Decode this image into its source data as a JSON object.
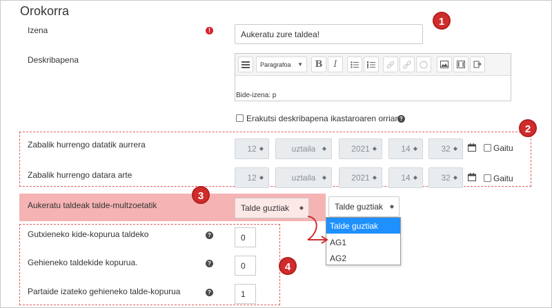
{
  "section": {
    "title": "Orokorra"
  },
  "name_field": {
    "label": "Izena",
    "required_mark": "!",
    "value": "Aukeratu zure taldea!"
  },
  "description": {
    "label": "Deskribapena",
    "toolbar": {
      "paragraph_select": "Paragrafoa",
      "bold": "B",
      "italic": "I",
      "buttons": [
        "collapse-icon",
        "bold-icon",
        "italic-icon",
        "unordered-list-icon",
        "ordered-list-icon",
        "link-icon",
        "unlink-icon",
        "emoji-icon",
        "image-icon",
        "media-icon",
        "manage-files-icon"
      ]
    },
    "path_label": "Bide-izena: p"
  },
  "show_description": {
    "label": "Erakutsi deskribapena ikastaroaren orrian",
    "help": "?"
  },
  "open_from": {
    "label": "Zabalik hurrengo datatik aurrera",
    "day": "12",
    "month": "uztaila",
    "year": "2021",
    "hour": "14",
    "minute": "32",
    "enable_label": "Gaitu"
  },
  "open_until": {
    "label": "Zabalik hurrengo datara arte",
    "day": "12",
    "month": "uztaila",
    "year": "2021",
    "hour": "14",
    "minute": "32",
    "enable_label": "Gaitu"
  },
  "grouping": {
    "label": "Aukeratu taldeak talde-multzoetatik",
    "selected": "Talde guztiak",
    "popup_selected": "Talde guztiak",
    "options": [
      "Talde guztiak",
      "AG1",
      "AG2"
    ]
  },
  "min_members": {
    "label": "Gutxieneko kide-kopurua taldeko",
    "help": "?",
    "value": "0"
  },
  "max_members": {
    "label": "Gehieneko taldekide kopurua.",
    "help": "?",
    "value": "0"
  },
  "max_groups": {
    "label": "Partaide izateko gehieneko talde-kopurua",
    "help": "?",
    "value": "1"
  },
  "badges": [
    "1",
    "2",
    "3",
    "4"
  ],
  "colors": {
    "annotation_red": "#d02c2c",
    "highlight_pink": "#f5b3b3",
    "dropdown_active": "#1e90ff"
  }
}
